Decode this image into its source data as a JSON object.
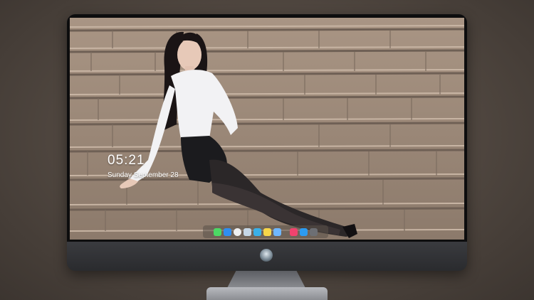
{
  "lockscreen": {
    "time": "05:21",
    "date_text": "Sunday September  28"
  },
  "wallpaper": {
    "colors": {
      "steps_light": "#b39e8c",
      "steps_dark": "#6f6055",
      "blouse": "#f2f2f4",
      "skirt": "#1b1b1e",
      "legs": "#2b2728"
    }
  },
  "monitor_logo": "alien-logo-icon",
  "dock": {
    "items": [
      {
        "name": "messages-icon",
        "color": "#4cd964"
      },
      {
        "name": "finder-icon",
        "color": "#2f8ef0"
      },
      {
        "name": "clock-icon",
        "color": "#f0f0f0"
      },
      {
        "name": "preview-icon",
        "color": "#c6d7e6"
      },
      {
        "name": "claquette-icon",
        "color": "#3ab0e8"
      },
      {
        "name": "notes-icon",
        "color": "#f7d548"
      },
      {
        "name": "photos-icon",
        "color": "#6fb7ff"
      },
      {
        "name": "music-icon",
        "color": "#f0436e"
      },
      {
        "name": "app-store-icon",
        "color": "#2d9bf0"
      },
      {
        "name": "screenshot-icon",
        "color": "#6d6f74"
      }
    ]
  }
}
